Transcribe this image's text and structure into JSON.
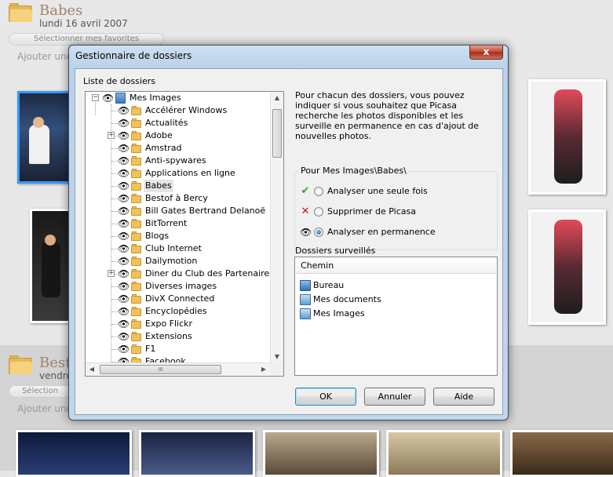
{
  "background": {
    "album1": {
      "title": "Babes",
      "date": "lundi 16 avril 2007",
      "fav_button": "Sélectionner mes favorites",
      "add_desc": "Ajouter une"
    },
    "album2": {
      "title": "Besto",
      "date": "vendre",
      "fav_button": "Sélection",
      "add_desc": "Ajouter une"
    }
  },
  "dialog": {
    "title": "Gestionnaire de dossiers",
    "close_label": "x",
    "folder_list_label": "Liste de dossiers",
    "tree": {
      "root": "Mes Images",
      "items": [
        {
          "label": "Accélérer Windows",
          "expandable": false
        },
        {
          "label": "Actualités",
          "expandable": false
        },
        {
          "label": "Adobe",
          "expandable": true
        },
        {
          "label": "Amstrad",
          "expandable": false
        },
        {
          "label": "Anti-spywares",
          "expandable": false
        },
        {
          "label": "Applications en ligne",
          "expandable": false
        },
        {
          "label": "Babes",
          "expandable": false,
          "selected": true
        },
        {
          "label": "Bestof à Bercy",
          "expandable": false
        },
        {
          "label": "Bill Gates  Bertrand Delanoë",
          "expandable": false
        },
        {
          "label": "BitTorrent",
          "expandable": false
        },
        {
          "label": "Blogs",
          "expandable": false
        },
        {
          "label": "Club Internet",
          "expandable": false
        },
        {
          "label": "Dailymotion",
          "expandable": false
        },
        {
          "label": "Diner du Club des Partenaires",
          "expandable": true
        },
        {
          "label": "Diverses images",
          "expandable": false
        },
        {
          "label": "DivX Connected",
          "expandable": false
        },
        {
          "label": "Encyclopédies",
          "expandable": false
        },
        {
          "label": "Expo Flickr",
          "expandable": false
        },
        {
          "label": "Extensions",
          "expandable": false
        },
        {
          "label": "F1",
          "expandable": false
        },
        {
          "label": "Facebook",
          "expandable": false
        }
      ],
      "hscroll_grip": "III"
    },
    "description": "Pour chacun des dossiers, vous pouvez indiquer si vous souhaitez que Picasa recherche les photos disponibles et les surveille en permanence en cas d'ajout de nouvelles photos.",
    "group_label": "Pour Mes Images\\Babes\\",
    "options": [
      {
        "status_icon": "✔",
        "label": "Analyser une seule fois",
        "checked": false
      },
      {
        "status_icon": "✕",
        "label": "Supprimer de Picasa",
        "checked": false
      },
      {
        "status_icon": "👁",
        "label": "Analyser en permanence",
        "checked": true
      }
    ],
    "watched_label": "Dossiers surveillés",
    "watched_header": "Chemin",
    "watched_items": [
      "Bureau",
      "Mes documents",
      "Mes Images"
    ],
    "buttons": {
      "ok": "OK",
      "cancel": "Annuler",
      "help": "Aide"
    },
    "colors": {
      "check": "#2e9e2e",
      "cross": "#b22222"
    }
  }
}
